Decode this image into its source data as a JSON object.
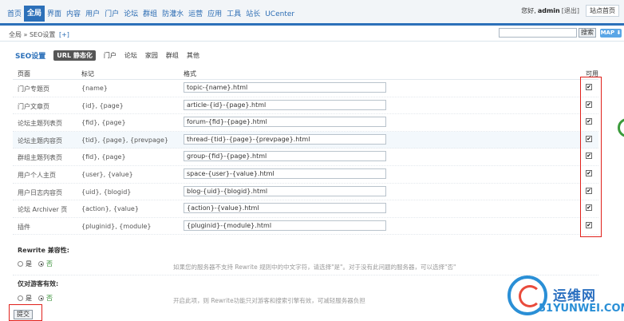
{
  "nav": {
    "items": [
      "首页",
      "全局",
      "界面",
      "内容",
      "用户",
      "门户",
      "论坛",
      "群组",
      "防灌水",
      "运营",
      "应用",
      "工具",
      "站长",
      "UCenter"
    ],
    "active_index": 1,
    "greeting": "您好,",
    "username": "admin",
    "logout": "[退出]",
    "site_home": "站点首页"
  },
  "breadcrumb": {
    "text": "全局 » SEO设置",
    "plus": "[+]"
  },
  "search": {
    "button": "搜索",
    "map_button": "MAP ⬇"
  },
  "subtabs": {
    "title": "SEO设置",
    "tabs": [
      "URL 静态化",
      "门户",
      "论坛",
      "家园",
      "群组",
      "其他"
    ],
    "active_index": 0
  },
  "table": {
    "headers": {
      "page": "页面",
      "mark": "标记",
      "format": "格式",
      "enabled": "可用"
    },
    "rows": [
      {
        "page": "门户专题页",
        "mark": "{name}",
        "format": "topic-{name}.html",
        "checked": true
      },
      {
        "page": "门户文章页",
        "mark": "{id}, {page}",
        "format": "article-{id}-{page}.html",
        "checked": true
      },
      {
        "page": "论坛主题列表页",
        "mark": "{fid}, {page}",
        "format": "forum-{fid}-{page}.html",
        "checked": true
      },
      {
        "page": "论坛主题内容页",
        "mark": "{tid}, {page}, {prevpage}",
        "format": "thread-{tid}-{page}-{prevpage}.html",
        "checked": true
      },
      {
        "page": "群组主题列表页",
        "mark": "{fid}, {page}",
        "format": "group-{fid}-{page}.html",
        "checked": true
      },
      {
        "page": "用户个人主页",
        "mark": "{user}, {value}",
        "format": "space-{user}-{value}.html",
        "checked": true
      },
      {
        "page": "用户日志内容页",
        "mark": "{uid}, {blogid}",
        "format": "blog-{uid}-{blogid}.html",
        "checked": true
      },
      {
        "page": "论坛 Archiver 页",
        "mark": "{action}, {value}",
        "format": "{action}-{value}.html",
        "checked": true
      },
      {
        "page": "插件",
        "mark": "{pluginid}, {module}",
        "format": "{pluginid}-{module}.html",
        "checked": true
      }
    ],
    "check_glyph": "✔"
  },
  "options": {
    "rewrite_compat": {
      "title": "Rewrite 兼容性:",
      "yes": "是",
      "no": "否",
      "selected": "no",
      "hint": "如果您的服务器不支持 Rewrite 规则中的中文字符，请选择\"是\"。对于没有此问题的服务器，可以选择\"否\""
    },
    "guest_only": {
      "title": "仅对游客有效:",
      "yes": "是",
      "no": "否",
      "selected": "no",
      "hint": "开启此项，则 Rewrite功能只对游客和搜索引擎有效，可减轻服务器负担"
    }
  },
  "submit_label": "提交",
  "watermark": {
    "cn": "运维网",
    "en": "51YUNWEI.COM"
  },
  "colors": {
    "accent": "#2c70b9",
    "highlight_box": "#e0201b",
    "radio_selected_text": "#2e8b2e"
  }
}
